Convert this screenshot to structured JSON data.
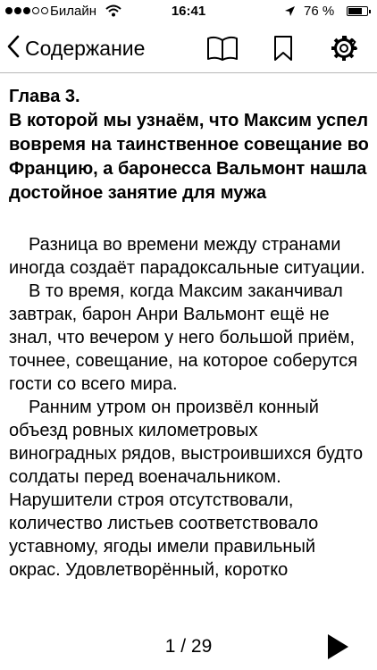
{
  "status_bar": {
    "carrier": "Билайн",
    "time": "16:41",
    "battery_pct": "76 %",
    "battery_level": 0.76,
    "signal_bars_filled": 3,
    "signal_bars_total": 5
  },
  "nav_bar": {
    "back_label": "Содержание",
    "icons": [
      "chevron-left-icon",
      "book-icon",
      "bookmark-icon",
      "gear-icon"
    ]
  },
  "chapter": {
    "title_line1": "Глава 3.",
    "title_line2": "В которой мы узнаём, что Максим успел вовремя на таинственное совещание во Францию, а баронесса Вальмонт нашла достойное занятие для мужа",
    "paragraphs": [
      "Разница во времени между странами иногда создаёт парадоксальные ситуации.",
      "В то время, когда Максим заканчивал завтрак, барон Анри Вальмонт ещё не знал, что вечером у него большой приём, точнее, совещание, на которое соберутся гости со всего мира.",
      "Ранним утром он произвёл конный объезд ровных километровых виноградных рядов, выстроившихся будто солдаты перед военачальником. Нарушители строя отсутствовали, количество листьев соответствовало уставному, ягоды имели правильный окрас. Удовлетворённый, коротко"
    ]
  },
  "footer": {
    "page_indicator": "1 / 29"
  }
}
